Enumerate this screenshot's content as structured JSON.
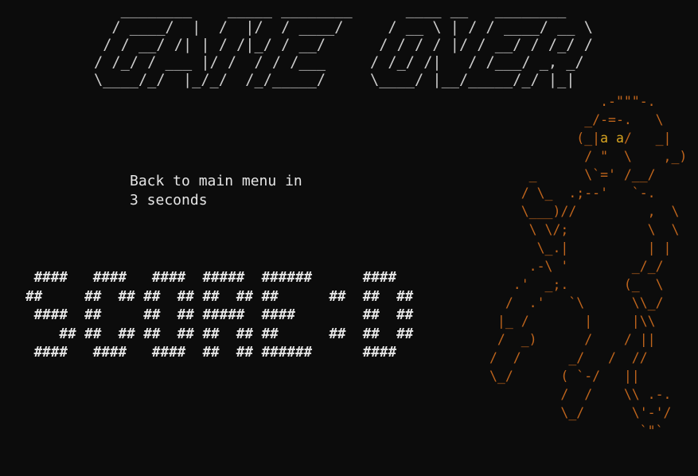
{
  "title_art": "   ________    _____ ________      ____ __   ________\n  / ____/  |  /  |/  / ____/     / __ \\ | / / ____/ __ \\\n / / __/ /| | / /|_/ / __/      / / / / |/ / __/ / /_/ /\n/ /_/ / ___ |/ /  / / /___     / /_/ /|   / /___/ _, _/\n\\____/_/  |_/_/  /_/_____/     \\____/ |__/_____/_/ |_|",
  "countdown": {
    "line1": "Back to main menu in",
    "line2": "3 seconds"
  },
  "score_art": " ####   ####   ####  #####  ######      ####\n##     ##  ## ##  ## ##  ## ##      ##  ##  ##\n ####  ##     ##  ## #####  ####        ##  ##\n    ## ##  ## ##  ## ##  ## ##      ##  ##  ##\n ####   ####   ####  ##  ## ######      ####",
  "monkey_art": {
    "line_01": "              .-\"\"\"-.",
    "line_02": "            _/-=-.   \\",
    "line_03_a": "           (_|",
    "line_03_eyes": "a a",
    "line_03_b": "/   _|",
    "line_04": "            / \"  \\    ,_)",
    "line_05": "     _      \\`=' /__/",
    "line_06": "    / \\_  .;--'   `-.",
    "line_07": "    \\___)//         ,  \\",
    "line_08": "     \\ \\/;          \\  \\",
    "line_09": "      \\_.|          | |",
    "line_10": "     .-\\ '        _/_/",
    "line_11": "   .'  _;.       (_  \\",
    "line_12": "  /  .'   `\\      \\\\_/",
    "line_13": " |_ /       |     |\\\\",
    "line_14": " /  _)      /    / ||",
    "line_15": "/  /      _/   /  //",
    "line_16": "\\_/      ( `-/   ||",
    "line_17": "         /  /    \\\\ .-.",
    "line_18": "         \\_/      \\'-'/",
    "line_19": "                   `\"`"
  },
  "colors": {
    "background": "#0c0c0c",
    "text": "#cccccc",
    "monkey": "#c0651c",
    "monkey_eyes": "#d9a521"
  }
}
